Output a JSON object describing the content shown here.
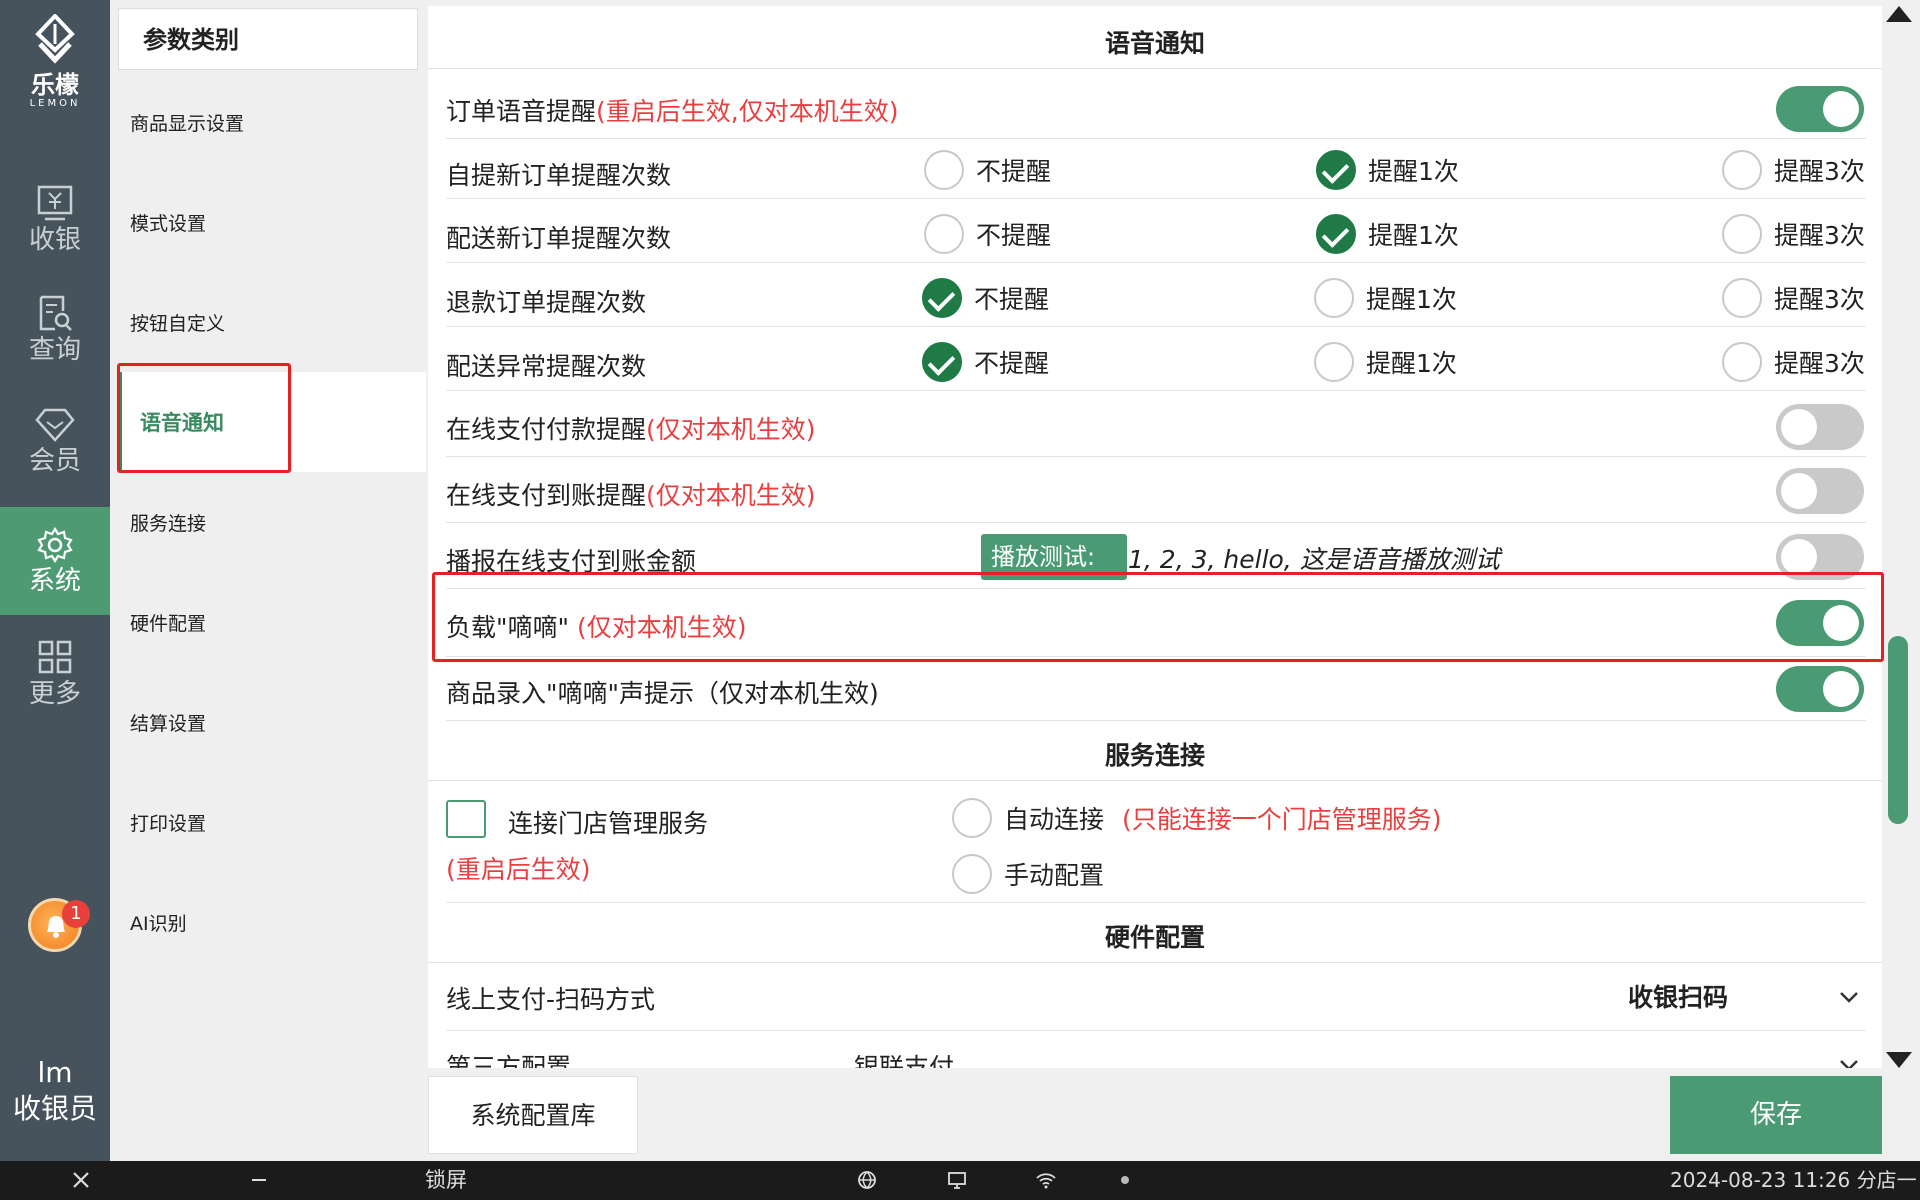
{
  "brand": {
    "name": "乐檬",
    "sub": "LEMON"
  },
  "rail": {
    "items": [
      {
        "label": "收银",
        "icon": "cashier-icon"
      },
      {
        "label": "查询",
        "icon": "query-icon"
      },
      {
        "label": "会员",
        "icon": "member-icon"
      },
      {
        "label": "系统",
        "icon": "gear-icon",
        "active": true
      },
      {
        "label": "更多",
        "icon": "grid-icon"
      }
    ],
    "badge_count": "1",
    "user_short": "lm",
    "user_role": "收银员"
  },
  "categories": {
    "header": "参数类别",
    "items": [
      "商品显示设置",
      "模式设置",
      "按钮自定义",
      "语音通知",
      "服务连接",
      "硬件配置",
      "结算设置",
      "打印设置",
      "AI识别"
    ],
    "active_index": 3
  },
  "voice": {
    "title": "语音通知",
    "order_voice": {
      "label": "订单语音提醒",
      "note": "(重启后生效,仅对本机生效)",
      "on": true
    },
    "radio_rows": [
      {
        "label": "自提新订单提醒次数",
        "options": [
          "不提醒",
          "提醒1次",
          "提醒3次"
        ],
        "selected": 1
      },
      {
        "label": "配送新订单提醒次数",
        "options": [
          "不提醒",
          "提醒1次",
          "提醒3次"
        ],
        "selected": 1
      },
      {
        "label": "退款订单提醒次数",
        "options": [
          "不提醒",
          "提醒1次",
          "提醒3次"
        ],
        "selected": 0
      },
      {
        "label": "配送异常提醒次数",
        "options": [
          "不提醒",
          "提醒1次",
          "提醒3次"
        ],
        "selected": 0
      }
    ],
    "online_pay_remind": {
      "label": "在线支付付款提醒",
      "note": "(仅对本机生效)",
      "on": false
    },
    "online_arrive_remind": {
      "label": "在线支付到账提醒",
      "note": "(仅对本机生效)",
      "on": false
    },
    "broadcast_amount": {
      "label": "播报在线支付到账金额",
      "play_label": "播放测试:",
      "play_text": "1, 2, 3, hello, 这是语音播放测试",
      "on": false
    },
    "load_beep": {
      "label": "负载\"嘀嘀\"",
      "note": "(仅对本机生效)",
      "on": true
    },
    "goods_beep": {
      "label": "商品录入\"嘀嘀\"声提示（仅对本机生效)",
      "on": true
    }
  },
  "service": {
    "title": "服务连接",
    "connect_label": "连接门店管理服务",
    "restart_note": "(重启后生效)",
    "auto_label": "自动连接",
    "auto_note": "(只能连接一个门店管理服务)",
    "manual_label": "手动配置"
  },
  "hardware": {
    "title": "硬件配置",
    "scan_label": "线上支付-扫码方式",
    "scan_value": "收银扫码",
    "third_label": "第三方配置",
    "third_value": "银联支付"
  },
  "footer": {
    "library_label": "系统配置库",
    "save_label": "保存"
  },
  "taskbar": {
    "lock_label": "锁屏",
    "datetime": "2024-08-23 11:26",
    "store": "分店一"
  },
  "colors": {
    "accent": "#4a9a73",
    "note_red": "#e84040",
    "rail_bg": "#46535c",
    "highlight_box": "#e52222"
  }
}
